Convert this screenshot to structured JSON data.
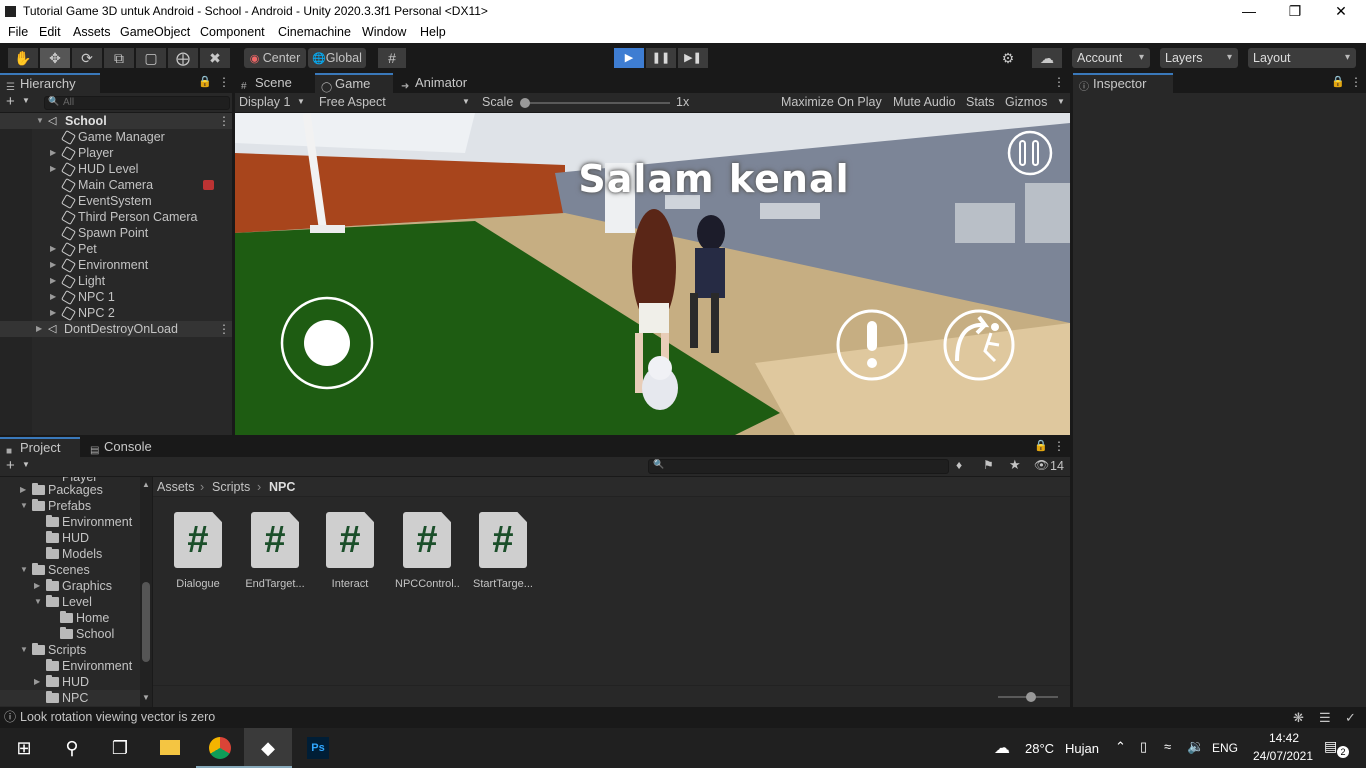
{
  "window": {
    "title": "Tutorial Game 3D untuk Android - School - Android - Unity 2020.3.3f1 Personal <DX11>"
  },
  "menu": [
    "File",
    "Edit",
    "Assets",
    "GameObject",
    "Component",
    "Cinemachine",
    "Window",
    "Help"
  ],
  "toolbar": {
    "pivot": "Center",
    "space": "Global",
    "account": "Account",
    "layers": "Layers",
    "layout": "Layout"
  },
  "hierarchy": {
    "tab": "Hierarchy",
    "search_placeholder": "All",
    "scene": "School",
    "items": [
      "Game Manager",
      "Player",
      "HUD Level",
      "Main Camera",
      "EventSystem",
      "Third Person Camera",
      "Spawn Point",
      "Pet",
      "Environment",
      "Light",
      "NPC 1",
      "NPC 2"
    ],
    "dont_destroy": "DontDestroyOnLoad"
  },
  "center_tabs": {
    "scene": "Scene",
    "game": "Game",
    "animator": "Animator"
  },
  "game_bar": {
    "display": "Display 1",
    "aspect": "Free Aspect",
    "scale_label": "Scale",
    "scale_value": "1x",
    "maximize": "Maximize On Play",
    "mute": "Mute Audio",
    "stats": "Stats",
    "gizmos": "Gizmos"
  },
  "game_view": {
    "dialogue_text": "Salam kenal"
  },
  "inspector": {
    "tab": "Inspector"
  },
  "project": {
    "tab": "Project",
    "console_tab": "Console",
    "hidden_count": "14",
    "breadcrumb": [
      "Assets",
      "Scripts",
      "NPC"
    ],
    "tree": {
      "partial_top": "Player",
      "packages": "Packages",
      "prefabs": "Prefabs",
      "prefabs_children": [
        "Environment",
        "HUD",
        "Models"
      ],
      "scenes": "Scenes",
      "graphics": "Graphics",
      "level": "Level",
      "level_children": [
        "Home",
        "School"
      ],
      "scripts": "Scripts",
      "scripts_children": [
        "Environment",
        "HUD",
        "NPC"
      ]
    },
    "assets": [
      "Dialogue",
      "EndTarget...",
      "Interact",
      "NPCControl...",
      "StartTarge..."
    ]
  },
  "status": {
    "message": "Look rotation viewing vector is zero"
  },
  "taskbar": {
    "weather_temp": "28°C",
    "weather_desc": "Hujan",
    "lang": "ENG",
    "time": "14:42",
    "date": "24/07/2021",
    "notifications": "2"
  }
}
